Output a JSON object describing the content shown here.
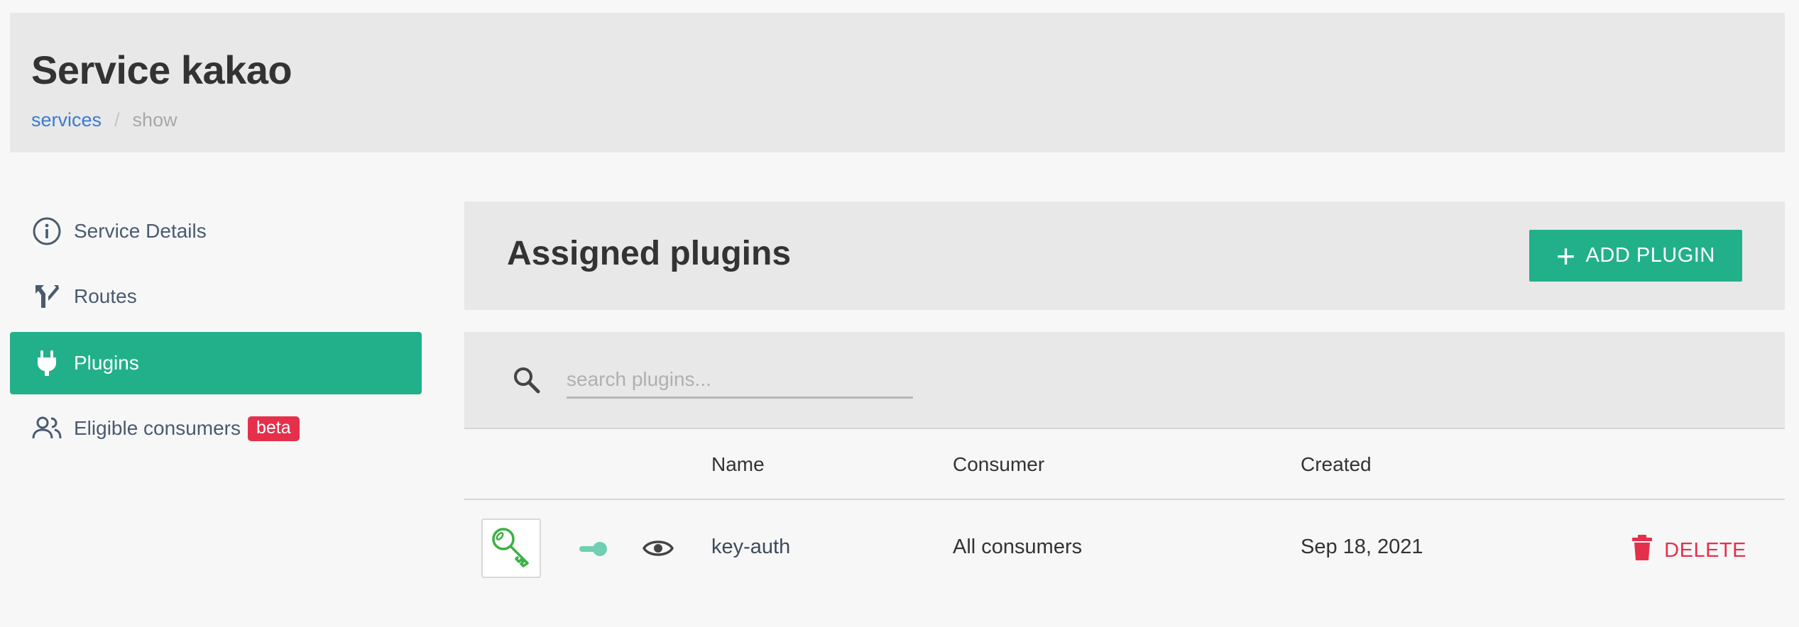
{
  "header": {
    "title": "Service kakao",
    "breadcrumb": {
      "link": "services",
      "separator": "/",
      "current": "show"
    }
  },
  "sidebar": {
    "items": [
      {
        "label": "Service Details",
        "icon": "info-circle-icon"
      },
      {
        "label": "Routes",
        "icon": "routes-fork-icon"
      },
      {
        "label": "Plugins",
        "icon": "plug-icon",
        "active": true
      },
      {
        "label": "Eligible consumers",
        "icon": "users-icon",
        "badge": "beta"
      }
    ]
  },
  "panel": {
    "title": "Assigned plugins",
    "add_button": "ADD PLUGIN"
  },
  "search": {
    "placeholder": "search plugins..."
  },
  "table": {
    "columns": [
      "Name",
      "Consumer",
      "Created"
    ],
    "rows": [
      {
        "icon": "key-icon",
        "enabled": true,
        "name": "key-auth",
        "consumer": "All consumers",
        "created": "Sep 18, 2021",
        "delete_label": "DELETE"
      }
    ]
  },
  "colors": {
    "accent": "#22b08a",
    "danger": "#e5304b",
    "link": "#3a7bd5",
    "key_icon": "#3cb043",
    "toggle": "#6fcfb2"
  }
}
